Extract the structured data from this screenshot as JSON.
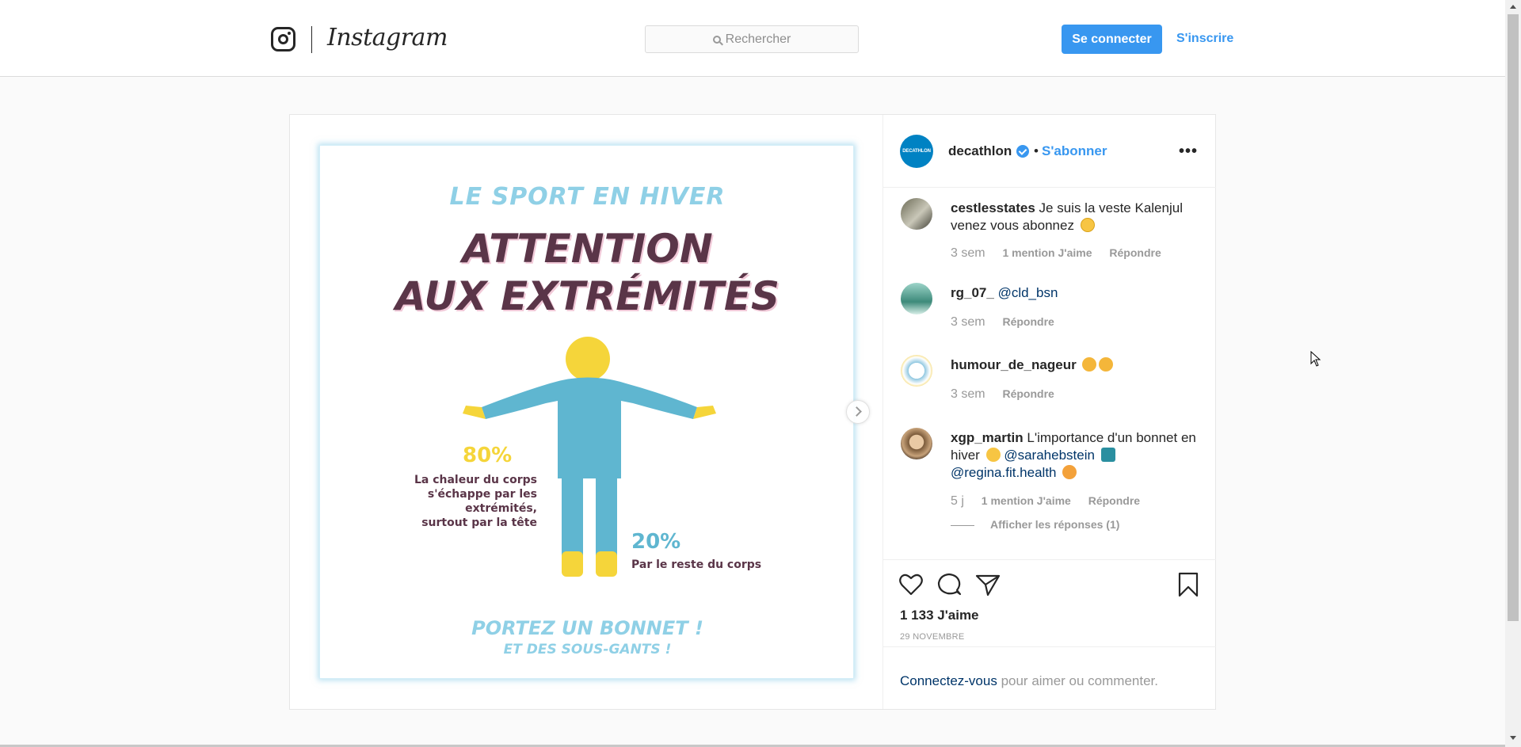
{
  "header": {
    "brand": "Instagram",
    "search_placeholder": "Rechercher",
    "login_label": "Se connecter",
    "signup_label": "S'inscrire"
  },
  "post": {
    "owner": "decathlon",
    "avatar_text": "DECATHLON",
    "dot": "•",
    "follow_label": "S'abonner",
    "more_label": "•••",
    "image": {
      "kicker": "LE SPORT EN HIVER",
      "headline_line1": "ATTENTION",
      "headline_line2": "AUX EXTRÉMITÉS",
      "stat_left_value": "80%",
      "stat_left_line1": "La chaleur du corps",
      "stat_left_line2": "s'échappe par les extrémités,",
      "stat_left_line3": "surtout par la tête",
      "stat_right_value": "20%",
      "stat_right_text": "Par le reste du corps",
      "footer_line1": "PORTEZ UN BONNET !",
      "footer_line2": "ET DES SOUS-GANTS !"
    },
    "comments": [
      {
        "user": "cestlesstates",
        "text": "Je suis la veste Kalenjul venez vous abonnez",
        "time": "3 sem",
        "likes": "1 mention J'aime",
        "reply": "Répondre"
      },
      {
        "user": "rg_07_",
        "mention": "@cld_bsn",
        "time": "3 sem",
        "reply": "Répondre"
      },
      {
        "user": "humour_de_nageur",
        "time": "3 sem",
        "reply": "Répondre"
      },
      {
        "user": "xgp_martin",
        "text": "L'importance d'un bonnet en hiver",
        "mention1": "@sarahebstein",
        "mention2": "@regina.fit.health",
        "time": "5 j",
        "likes": "1 mention J'aime",
        "reply": "Répondre",
        "replies_label": "Afficher les réponses (1)"
      }
    ],
    "likes_count": "1 133 J'aime",
    "date": "29 NOVEMBRE",
    "login_link": "Connectez-vous",
    "login_rest": " pour aimer ou commenter."
  },
  "colors": {
    "accent": "#3897f0",
    "brand_blue": "#0082c3",
    "figure_blue": "#5fb6d0",
    "figure_yellow": "#f5d53a",
    "headline": "#5a3548"
  },
  "icons": [
    "instagram-glyph-icon",
    "search-icon",
    "verified-icon",
    "more-icon",
    "next-arrow-icon",
    "heart-icon",
    "comment-icon",
    "share-icon",
    "bookmark-icon"
  ]
}
